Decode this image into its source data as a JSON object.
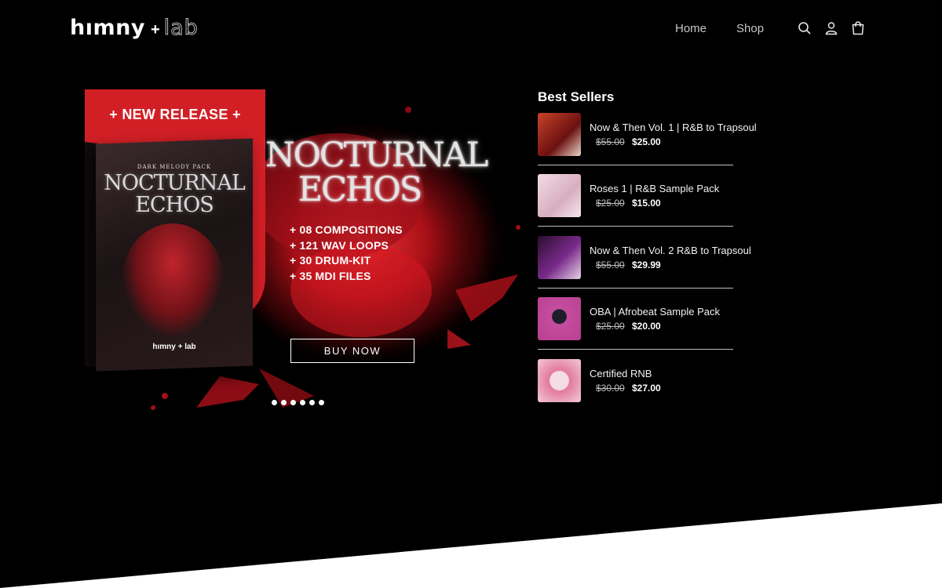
{
  "header": {
    "logo_main": "hımny",
    "logo_plus": "+",
    "logo_lab": "lab",
    "nav": [
      {
        "label": "Home"
      },
      {
        "label": "Shop"
      }
    ],
    "icons": [
      "search-icon",
      "account-icon",
      "cart-icon"
    ]
  },
  "banner": {
    "badge": "+ NEW RELEASE +",
    "box_subtitle": "DARK MELODY PACK",
    "box_title": "NOCTURNAL ECHOS",
    "box_logo": "hımny + lab",
    "title": "NOCTURNAL ECHOS",
    "features": [
      "+ 08 COMPOSITIONS",
      "+ 121 WAV LOOPS",
      "+ 30 DRUM-KIT",
      "+ 35 MDI FILES"
    ],
    "cta": "BUY NOW",
    "slide_count": 6,
    "accent_color": "#d21f26"
  },
  "best_sellers": {
    "title": "Best Sellers",
    "items": [
      {
        "name": "Now & Then Vol. 1 | R&B to Trapsoul",
        "old_price": "$55.00",
        "price": "$25.00",
        "thumb_color": "#8a1e18"
      },
      {
        "name": "Roses 1 | R&B Sample Pack",
        "old_price": "$25.00",
        "price": "$15.00",
        "thumb_color": "#e3c6d2"
      },
      {
        "name": "Now & Then Vol. 2 R&B to Trapsoul",
        "old_price": "$55.00",
        "price": "$29.99",
        "thumb_color": "#3a1740"
      },
      {
        "name": "OBA | Afrobeat Sample Pack",
        "old_price": "$25.00",
        "price": "$20.00",
        "thumb_color": "#c04a9a"
      },
      {
        "name": "Certified RNB",
        "old_price": "$30.00",
        "price": "$27.00",
        "thumb_color": "#e07a98"
      }
    ]
  }
}
